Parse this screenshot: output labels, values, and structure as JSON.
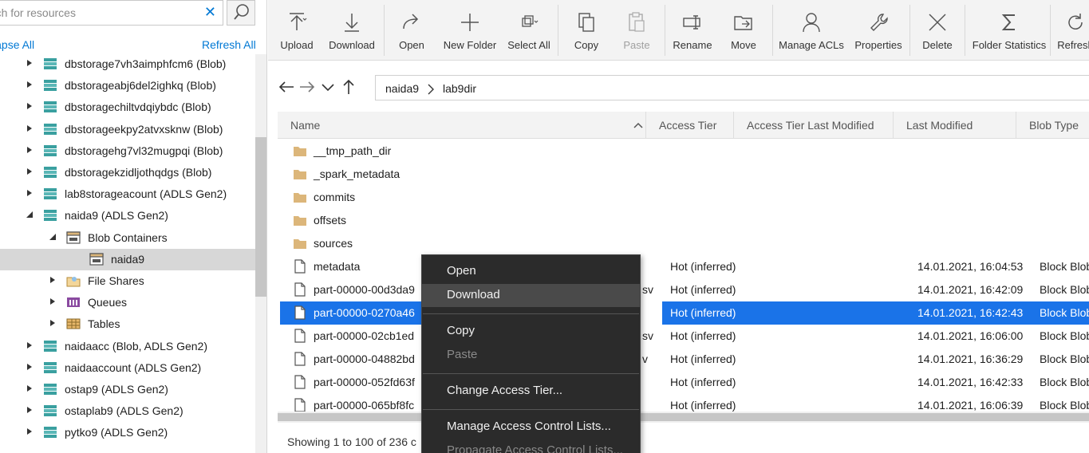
{
  "explorer": {
    "search_placeholder": "Search for resources",
    "collapse_all": "Collapse All",
    "refresh_all": "Refresh All",
    "tree": [
      {
        "label": "dbstorage7vh3aimphfcm6 (Blob)",
        "icon": "storage-account-icon",
        "depth": 1,
        "expanded": false
      },
      {
        "label": "dbstorageabj6del2ighkq (Blob)",
        "icon": "storage-account-icon",
        "depth": 1,
        "expanded": false
      },
      {
        "label": "dbstoragechiltvdqiybdc (Blob)",
        "icon": "storage-account-icon",
        "depth": 1,
        "expanded": false
      },
      {
        "label": "dbstorageekpy2atvxsknw (Blob)",
        "icon": "storage-account-icon",
        "depth": 1,
        "expanded": false
      },
      {
        "label": "dbstoragehg7vl32mugpqi (Blob)",
        "icon": "storage-account-icon",
        "depth": 1,
        "expanded": false
      },
      {
        "label": "dbstoragekzidljothqdgs (Blob)",
        "icon": "storage-account-icon",
        "depth": 1,
        "expanded": false
      },
      {
        "label": "lab8storageacount (ADLS Gen2)",
        "icon": "storage-account-icon",
        "depth": 1,
        "expanded": false
      },
      {
        "label": "naida9 (ADLS Gen2)",
        "icon": "storage-account-icon",
        "depth": 1,
        "expanded": true
      },
      {
        "label": "Blob Containers",
        "icon": "blob-containers-icon",
        "depth": 2,
        "expanded": true
      },
      {
        "label": "naida9",
        "icon": "container-icon",
        "depth": 3,
        "expanded": null,
        "selected": true
      },
      {
        "label": "File Shares",
        "icon": "file-shares-icon",
        "depth": 2,
        "expanded": false
      },
      {
        "label": "Queues",
        "icon": "queues-icon",
        "depth": 2,
        "expanded": false
      },
      {
        "label": "Tables",
        "icon": "tables-icon",
        "depth": 2,
        "expanded": false
      },
      {
        "label": "naidaacc (Blob, ADLS Gen2)",
        "icon": "storage-account-icon",
        "depth": 1,
        "expanded": false
      },
      {
        "label": "naidaaccount (ADLS Gen2)",
        "icon": "storage-account-icon",
        "depth": 1,
        "expanded": false
      },
      {
        "label": "ostap9 (ADLS Gen2)",
        "icon": "storage-account-icon",
        "depth": 1,
        "expanded": false
      },
      {
        "label": "ostaplab9 (ADLS Gen2)",
        "icon": "storage-account-icon",
        "depth": 1,
        "expanded": false
      },
      {
        "label": "pytko9 (ADLS Gen2)",
        "icon": "storage-account-icon",
        "depth": 1,
        "expanded": false
      }
    ]
  },
  "toolbar": {
    "buttons": [
      {
        "label": "Upload",
        "icon": "upload-icon",
        "enabled": true
      },
      {
        "label": "Download",
        "icon": "download-icon",
        "enabled": true
      },
      {
        "label": "Open",
        "icon": "open-icon",
        "enabled": true
      },
      {
        "label": "New Folder",
        "icon": "new-folder-icon",
        "enabled": true
      },
      {
        "label": "Select All",
        "icon": "select-all-icon",
        "enabled": true
      },
      {
        "label": "Copy",
        "icon": "copy-icon",
        "enabled": true
      },
      {
        "label": "Paste",
        "icon": "paste-icon",
        "enabled": false
      },
      {
        "label": "Rename",
        "icon": "rename-icon",
        "enabled": true
      },
      {
        "label": "Move",
        "icon": "move-icon",
        "enabled": true
      },
      {
        "label": "Manage ACLs",
        "icon": "manage-acls-icon",
        "enabled": true
      },
      {
        "label": "Properties",
        "icon": "properties-icon",
        "enabled": true
      },
      {
        "label": "Delete",
        "icon": "delete-icon",
        "enabled": true
      },
      {
        "label": "Folder Statistics",
        "icon": "folder-statistics-icon",
        "enabled": true
      },
      {
        "label": "Refresh",
        "icon": "refresh-icon",
        "enabled": true
      }
    ]
  },
  "address": {
    "crumbs": [
      "naida9",
      "lab9dir"
    ]
  },
  "grid": {
    "columns": [
      "Name",
      "Access Tier",
      "Access Tier Last Modified",
      "Last Modified",
      "Blob Type"
    ],
    "rows": [
      {
        "type": "folder",
        "name": "__tmp_path_dir",
        "tier": "",
        "tier_modified": "",
        "modified": "",
        "blob_type": ""
      },
      {
        "type": "folder",
        "name": "_spark_metadata",
        "tier": "",
        "tier_modified": "",
        "modified": "",
        "blob_type": ""
      },
      {
        "type": "folder",
        "name": "commits",
        "tier": "",
        "tier_modified": "",
        "modified": "",
        "blob_type": ""
      },
      {
        "type": "folder",
        "name": "offsets",
        "tier": "",
        "tier_modified": "",
        "modified": "",
        "blob_type": ""
      },
      {
        "type": "folder",
        "name": "sources",
        "tier": "",
        "tier_modified": "",
        "modified": "",
        "blob_type": ""
      },
      {
        "type": "file",
        "name": "metadata",
        "tier": "Hot (inferred)",
        "tier_modified": "",
        "modified": "14.01.2021, 16:04:53",
        "blob_type": "Block Blob"
      },
      {
        "type": "file",
        "name": "part-00000-00d3da9",
        "ext": "sv",
        "tier": "Hot (inferred)",
        "tier_modified": "",
        "modified": "14.01.2021, 16:42:09",
        "blob_type": "Block Blob"
      },
      {
        "type": "file",
        "name": "part-00000-0270a46",
        "ext": "sv",
        "tier": "Hot (inferred)",
        "tier_modified": "",
        "modified": "14.01.2021, 16:42:43",
        "blob_type": "Block Blob",
        "selected": true
      },
      {
        "type": "file",
        "name": "part-00000-02cb1ed",
        "ext": "sv",
        "tier": "Hot (inferred)",
        "tier_modified": "",
        "modified": "14.01.2021, 16:06:00",
        "blob_type": "Block Blob"
      },
      {
        "type": "file",
        "name": "part-00000-04882bd",
        "ext": "v",
        "tier": "Hot (inferred)",
        "tier_modified": "",
        "modified": "14.01.2021, 16:36:29",
        "blob_type": "Block Blob"
      },
      {
        "type": "file",
        "name": "part-00000-052fd63f",
        "ext": "",
        "tier": "Hot (inferred)",
        "tier_modified": "",
        "modified": "14.01.2021, 16:42:33",
        "blob_type": "Block Blob"
      },
      {
        "type": "file",
        "name": "part-00000-065bf8fc",
        "ext": "",
        "tier": "Hot (inferred)",
        "tier_modified": "",
        "modified": "14.01.2021, 16:06:39",
        "blob_type": "Block Blob"
      }
    ]
  },
  "status": "Showing 1 to 100 of 236 c",
  "context_menu": {
    "items": [
      {
        "label": "Open",
        "enabled": true
      },
      {
        "label": "Download",
        "enabled": true,
        "hover": true
      },
      {
        "sep": true
      },
      {
        "label": "Copy",
        "enabled": true
      },
      {
        "label": "Paste",
        "enabled": false
      },
      {
        "sep": true
      },
      {
        "label": "Change Access Tier...",
        "enabled": true
      },
      {
        "sep": true
      },
      {
        "label": "Manage Access Control Lists...",
        "enabled": true
      },
      {
        "label": "Propagate Access Control Lists...",
        "enabled": false
      }
    ]
  },
  "colors": {
    "accent": "#0078d4",
    "selection": "#1a73e8",
    "folder": "#dcb67a",
    "storage": "#3aa0a0",
    "menu_bg": "#2b2b2b"
  }
}
